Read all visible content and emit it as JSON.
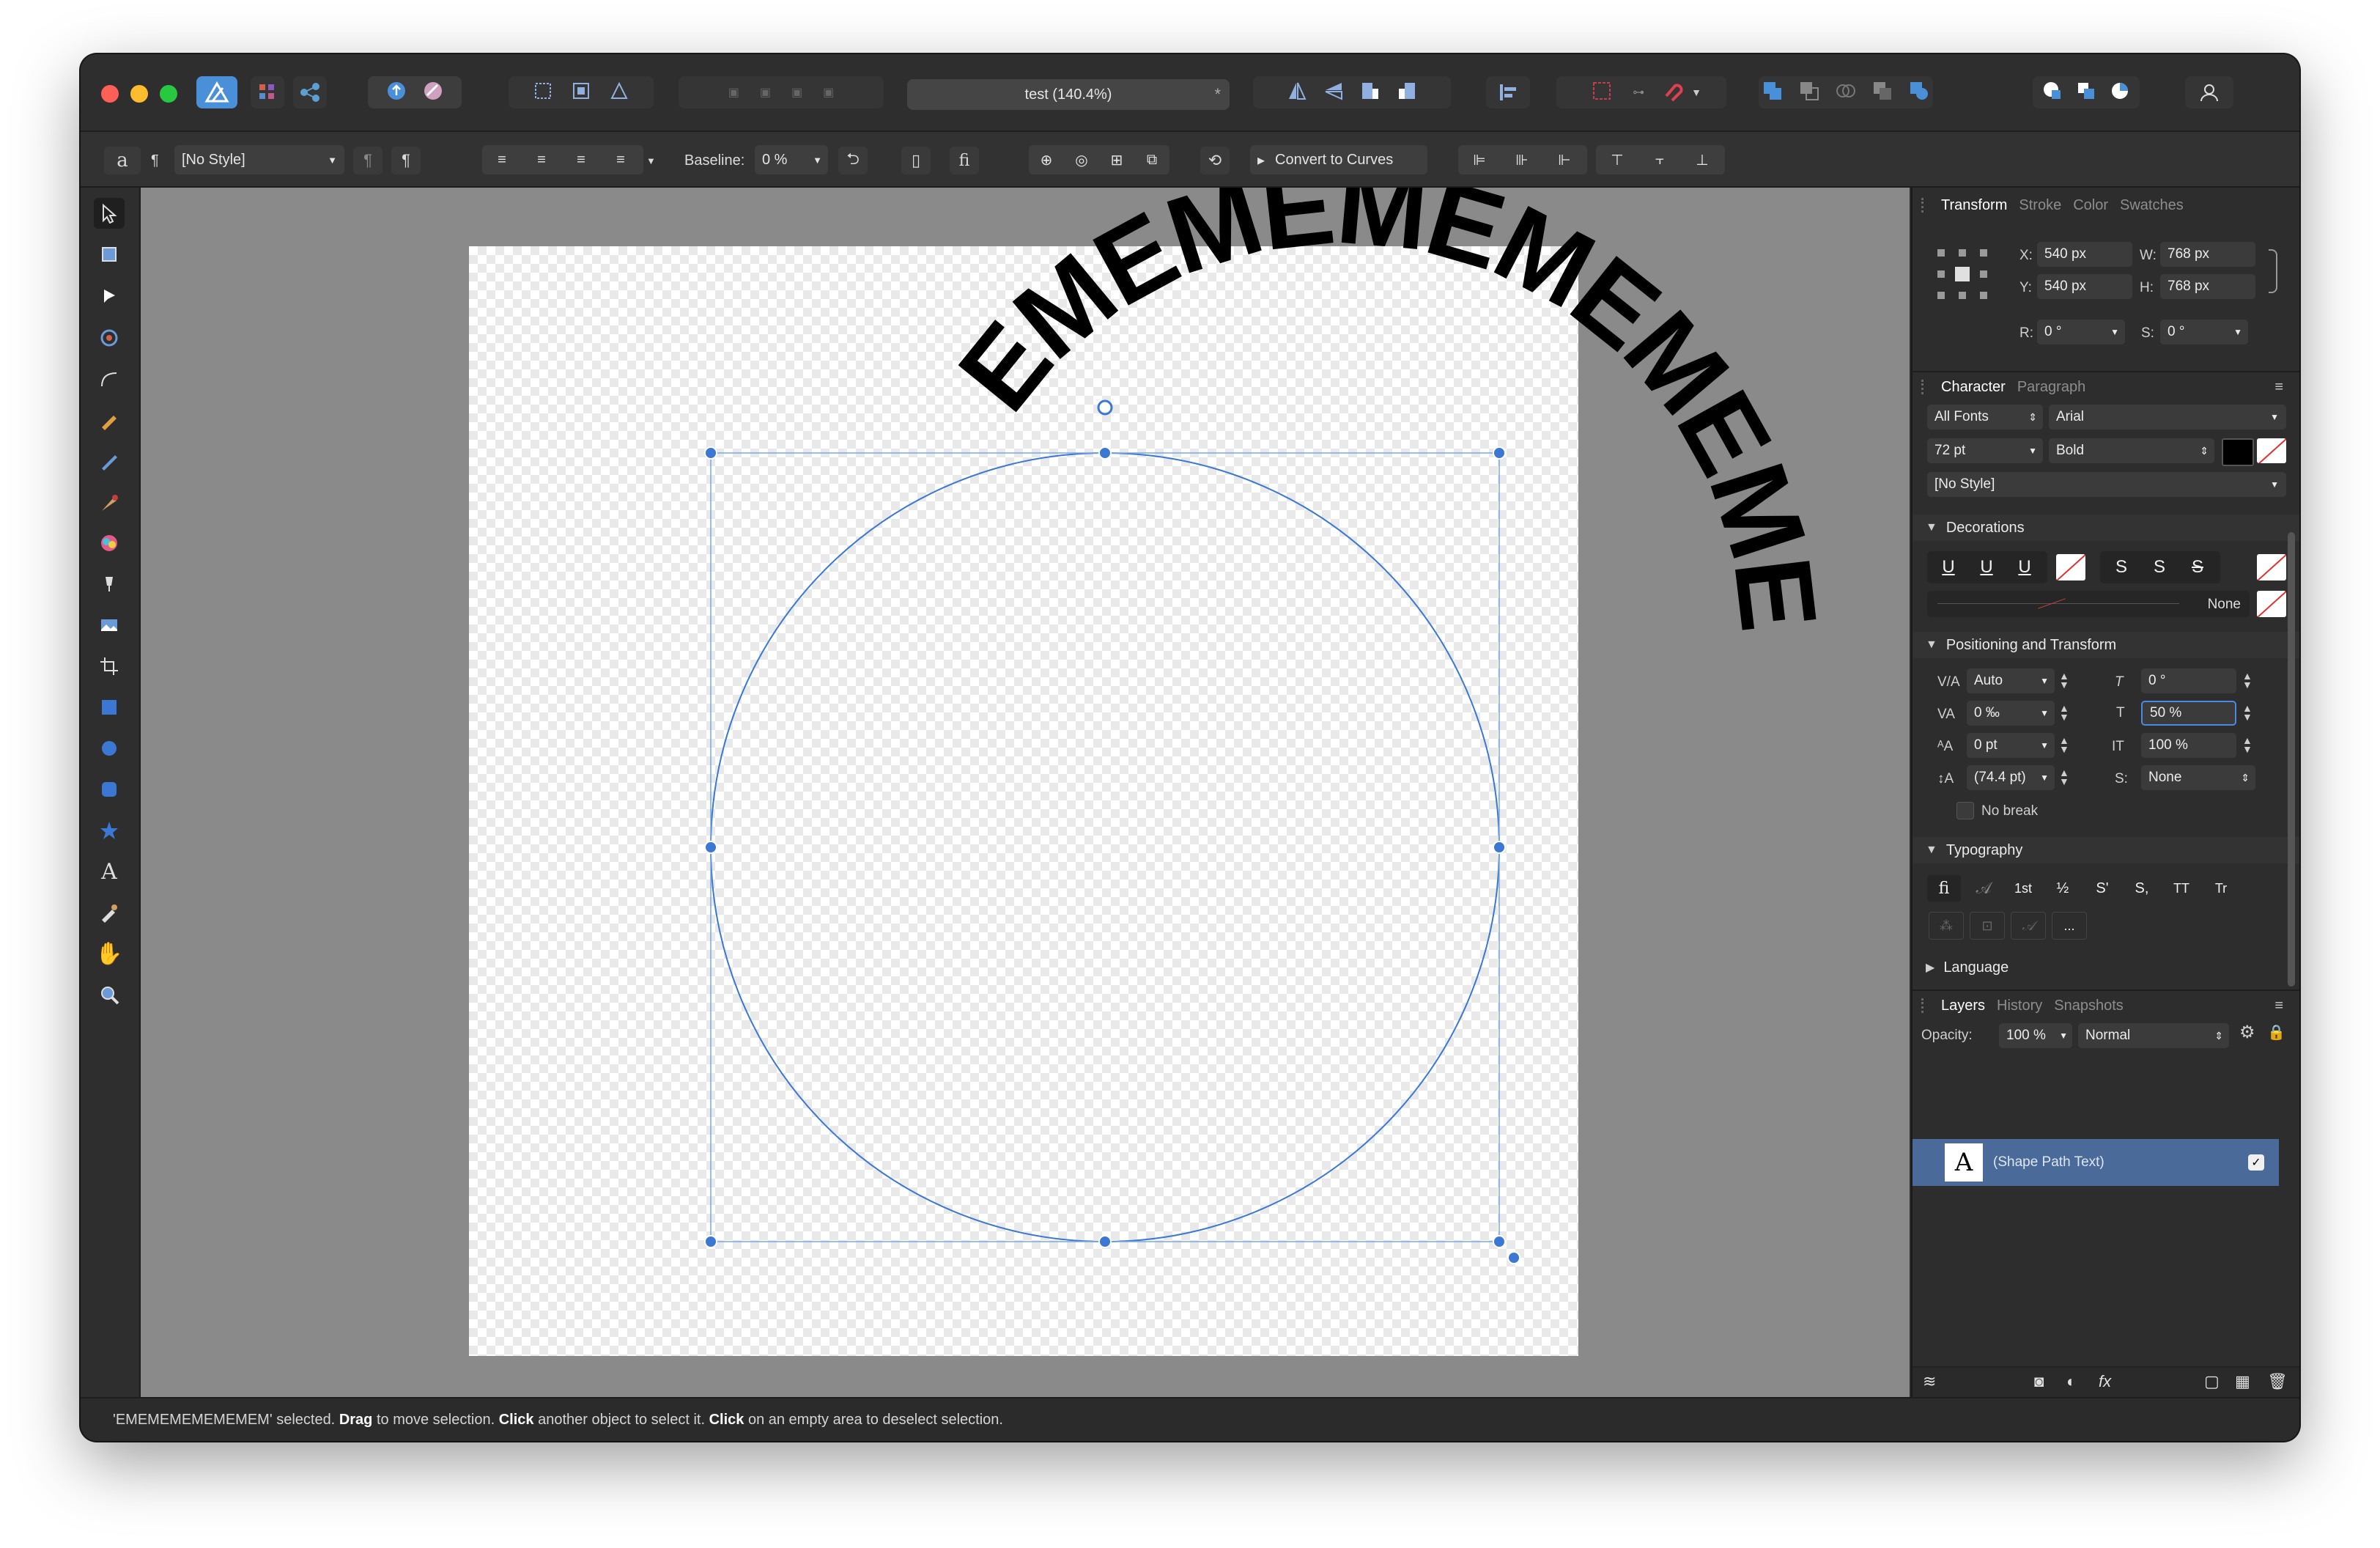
{
  "titlebar": {
    "document_title": "test (140.4%)",
    "unsaved_marker": "*"
  },
  "context_toolbar": {
    "char_style_glyph": "a",
    "para_glyph": "¶",
    "style_value": "[No Style]",
    "baseline_label": "Baseline:",
    "baseline_value": "0 %",
    "ligature_glyph": "fi",
    "convert_to_curves": "Convert to Curves"
  },
  "canvas": {
    "path_text": "EMEMEMEMEMEMEM"
  },
  "transform_panel": {
    "tabs": [
      "Transform",
      "Stroke",
      "Color",
      "Swatches"
    ],
    "x_label": "X:",
    "x_value": "540 px",
    "y_label": "Y:",
    "y_value": "540 px",
    "w_label": "W:",
    "w_value": "768 px",
    "h_label": "H:",
    "h_value": "768 px",
    "r_label": "R:",
    "r_value": "0 °",
    "s_label": "S:",
    "s_value": "0 °"
  },
  "character_panel": {
    "tabs": [
      "Character",
      "Paragraph"
    ],
    "font_collection": "All Fonts",
    "font_family": "Arial",
    "font_size": "72 pt",
    "font_weight": "Bold",
    "style": "[No Style]",
    "fill_color": "#000000",
    "decorations": {
      "title": "Decorations",
      "underline_buttons": [
        "U",
        "U",
        "U"
      ],
      "strike_buttons": [
        "S",
        "S",
        "S"
      ],
      "line_value": "None"
    },
    "positioning": {
      "title": "Positioning and Transform",
      "kerning": "Auto",
      "tracking": "0 ‰",
      "baseline_shift": "0 pt",
      "leading": "(74.4 pt)",
      "shear": "0 °",
      "vertical_scale": "50 %",
      "horizontal_scale": "100 %",
      "position": "None",
      "no_break_label": "No break"
    },
    "typography": {
      "title": "Typography",
      "row1": [
        "fi",
        "𝒜",
        "1st",
        "½",
        "S'",
        "S,",
        "TT",
        "Tr"
      ],
      "row2_last": "..."
    },
    "language_title": "Language"
  },
  "layers_panel": {
    "tabs": [
      "Layers",
      "History",
      "Snapshots"
    ],
    "opacity_label": "Opacity:",
    "opacity_value": "100 %",
    "blend_mode": "Normal",
    "layer_icon_letter": "A",
    "layer_name": "(Shape Path Text)",
    "layer_checkmark": "✓"
  },
  "statusbar": {
    "selected": "'EMEMEMEMEMEMEM' selected.",
    "drag": "Drag",
    "drag_text": "to move selection.",
    "click1": "Click",
    "click1_text": "another object to select it.",
    "click2": "Click",
    "click2_text": "on an empty area to deselect selection."
  },
  "colors": {
    "accent_blue": "#3a78d4",
    "selection_blue": "#2f6fd0",
    "layer_highlight": "#4a6b9a"
  }
}
